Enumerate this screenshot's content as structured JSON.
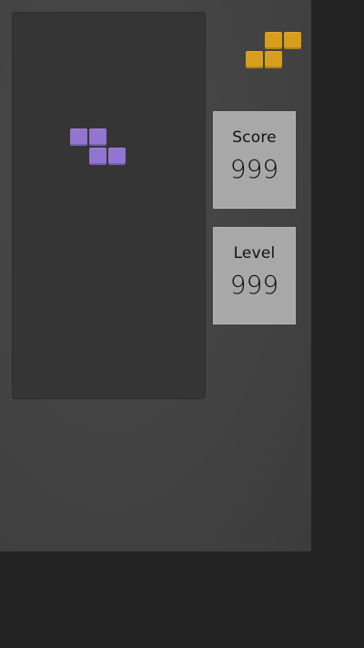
{
  "game": {
    "score_label": "Score",
    "score_value": "999",
    "level_label": "Level",
    "level_value": "999"
  },
  "colors": {
    "background": "#242424",
    "board": "#444444",
    "well": "#353535",
    "panel": "#a8a8a8",
    "current_piece": "#9275d0",
    "next_piece": "#d79e1e"
  },
  "pieces": {
    "current": {
      "shape": "Z",
      "color_name": "purple"
    },
    "next": {
      "shape": "S",
      "color_name": "orange"
    }
  }
}
